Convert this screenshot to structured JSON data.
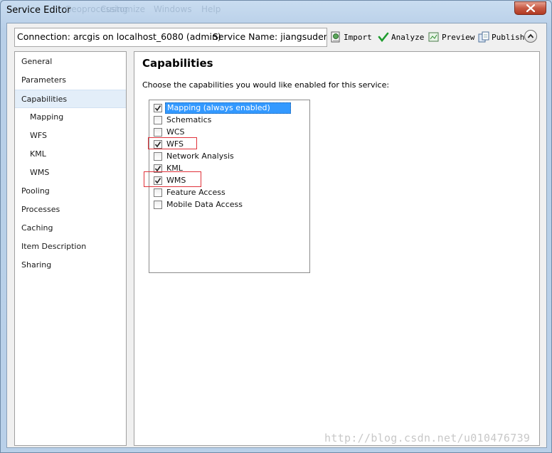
{
  "window": {
    "title": "Service Editor",
    "ghost_menu": [
      "Geoprocessing",
      "Customize",
      "Windows",
      "Help"
    ]
  },
  "toolbar": {
    "connection_text": "Connection: arcgis on localhost_6080 (admin)",
    "service_name_text": "Service Name: jiangsudemo",
    "import_label": "Import",
    "analyze_label": "Analyze",
    "preview_label": "Preview",
    "publish_label": "Publish"
  },
  "nav": {
    "items": [
      {
        "label": "General",
        "indent": false,
        "selected": false
      },
      {
        "label": "Parameters",
        "indent": false,
        "selected": false
      },
      {
        "label": "Capabilities",
        "indent": false,
        "selected": true
      },
      {
        "label": "Mapping",
        "indent": true,
        "selected": false
      },
      {
        "label": "WFS",
        "indent": true,
        "selected": false
      },
      {
        "label": "KML",
        "indent": true,
        "selected": false
      },
      {
        "label": "WMS",
        "indent": true,
        "selected": false
      },
      {
        "label": "Pooling",
        "indent": false,
        "selected": false
      },
      {
        "label": "Processes",
        "indent": false,
        "selected": false
      },
      {
        "label": "Caching",
        "indent": false,
        "selected": false
      },
      {
        "label": "Item Description",
        "indent": false,
        "selected": false
      },
      {
        "label": "Sharing",
        "indent": false,
        "selected": false
      }
    ]
  },
  "content": {
    "title": "Capabilities",
    "description": "Choose the capabilities you would like enabled for this service:",
    "capabilities": [
      {
        "label": "Mapping (always enabled)",
        "checked": true,
        "highlighted": true
      },
      {
        "label": "Schematics",
        "checked": false,
        "highlighted": false
      },
      {
        "label": "WCS",
        "checked": false,
        "highlighted": false
      },
      {
        "label": "WFS",
        "checked": true,
        "highlighted": false
      },
      {
        "label": "Network Analysis",
        "checked": false,
        "highlighted": false
      },
      {
        "label": "KML",
        "checked": true,
        "highlighted": false
      },
      {
        "label": "WMS",
        "checked": true,
        "highlighted": false
      },
      {
        "label": "Feature Access",
        "checked": false,
        "highlighted": false
      },
      {
        "label": "Mobile Data Access",
        "checked": false,
        "highlighted": false
      }
    ]
  },
  "watermark": "http://blog.csdn.net/u010476739",
  "colors": {
    "selection": "#3399ff",
    "annotation_red": "#e0323a",
    "nav_selected": "#e3eef9"
  }
}
